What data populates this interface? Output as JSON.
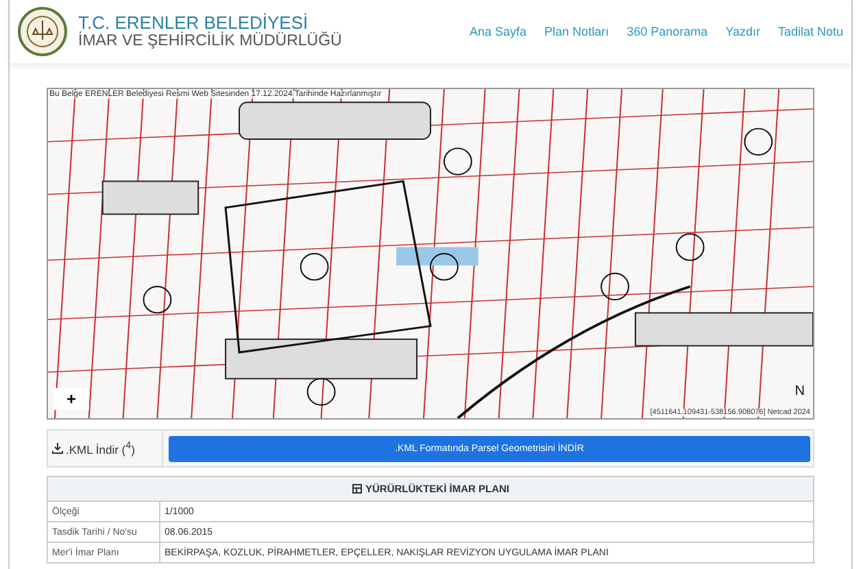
{
  "header": {
    "title": "T.C. ERENLER BELEDİYESİ",
    "subtitle": "İMAR VE ŞEHİRCİLİK MÜDÜRLÜĞÜ",
    "nav": [
      "Ana Sayfa",
      "Plan Notları",
      "360 Panorama",
      "Yazdır",
      "Tadilat Notu"
    ]
  },
  "map": {
    "caption": "Bu Belge ERENLER Belediyesi Resmi Web Sitesinden 17.12.2024 Tarihinde Hazırlanmıştır",
    "zoom_in": "+",
    "north": "N",
    "attribution": "[4511641.109431-538156.908076] Netcad 2024"
  },
  "kml": {
    "label": ".KML İndir ($^{4}$)",
    "button": ".KML Formatında Parsel Geometrisini İNDİR"
  },
  "plan_table": {
    "title": "YÜRÜRLÜKTEKİ İMAR PLANI",
    "rows": [
      {
        "label": "Ölçeği",
        "value": "1/1000"
      },
      {
        "label": "Tasdik Tarihi / No'su",
        "value": "08.06.2015"
      },
      {
        "label": "Mer'i İmar Planı",
        "value": "BEKİRPAŞA, KOZLUK, PİRAHMETLER, EPÇELLER, NAKIŞLAR REVİZYON UYGULAMA İMAR PLANI"
      }
    ]
  }
}
